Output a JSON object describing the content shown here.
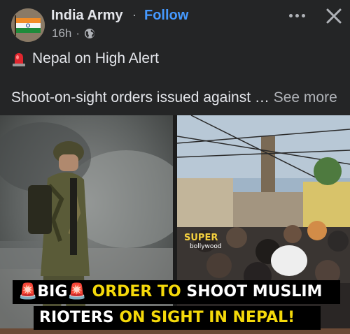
{
  "post": {
    "author": "India Army",
    "separator": "·",
    "follow_label": "Follow",
    "time": "16h",
    "meta_sep": "·",
    "privacy_icon": "globe-icon",
    "more_icon": "more-dots-icon",
    "close_icon": "close-icon",
    "text_line1": "Nepal on High Alert",
    "text_line1_icon": "siren-icon",
    "text_line2": "Shoot-on-sight orders issued against …",
    "see_more": "See more"
  },
  "media": {
    "watermark_brand": "SUPER",
    "watermark_sub": "bollywood",
    "caption_line1": {
      "part1": "BIG",
      "part2": "ORDER TO",
      "part3": "SHOOT MUSLIM"
    },
    "caption_line2": {
      "part1": "RIOTERS",
      "part2": "ON SIGHT IN NEPAL!"
    }
  },
  "colors": {
    "background": "#242526",
    "text": "#e4e6eb",
    "secondary_text": "#b0b3b8",
    "follow_blue": "#4599ff",
    "caption_highlight": "#f5d90a"
  }
}
